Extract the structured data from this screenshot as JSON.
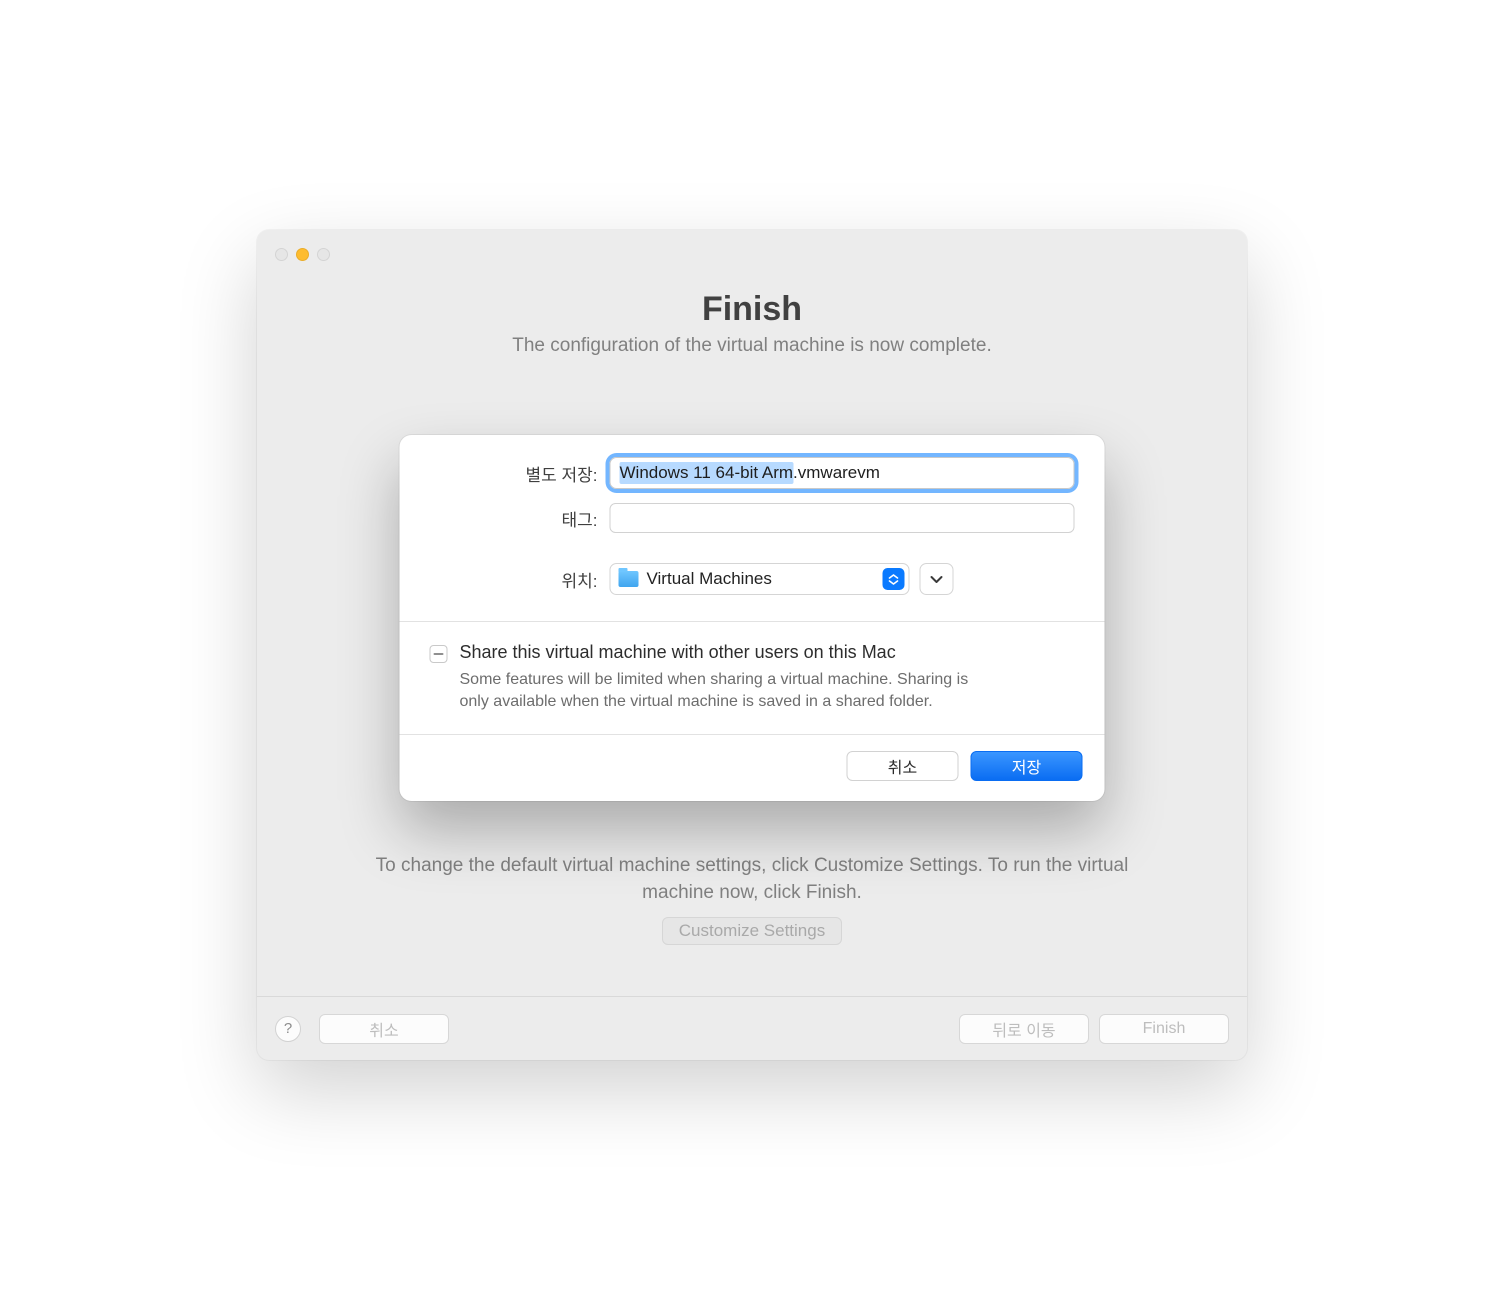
{
  "window": {
    "title": "Finish",
    "subtitle": "The configuration of the virtual machine is now complete.",
    "instructions": "To change the default virtual machine settings, click Customize Settings. To run the virtual machine now, click Finish.",
    "customize_button": "Customize Settings",
    "bottom_buttons": {
      "cancel": "취소",
      "back": "뒤로 이동",
      "finish": "Finish"
    },
    "help": "?"
  },
  "sheet": {
    "labels": {
      "save_as": "별도 저장:",
      "tags": "태그:",
      "where": "위치:"
    },
    "filename": {
      "selected_part": "Windows 11 64-bit Arm",
      "rest_part": ".vmwarevm",
      "full": "Windows 11 64-bit Arm.vmwarevm"
    },
    "tags_value": "",
    "location": "Virtual Machines",
    "share": {
      "title": "Share this virtual machine with other users on this Mac",
      "desc": "Some features will be limited when sharing a virtual machine. Sharing is only available when the virtual machine is saved in a shared folder."
    },
    "buttons": {
      "cancel": "취소",
      "save": "저장"
    }
  }
}
